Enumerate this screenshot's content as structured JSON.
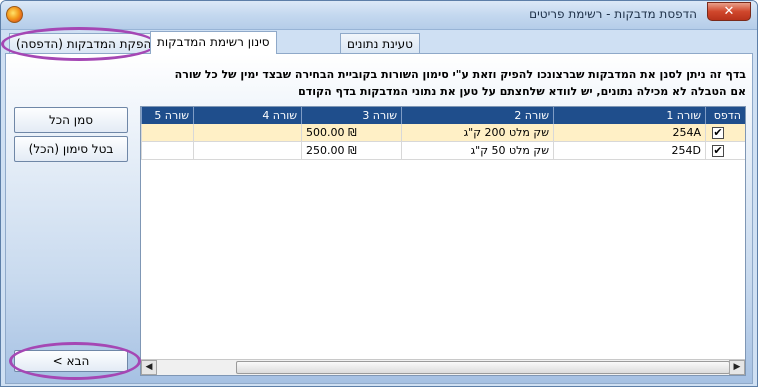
{
  "window": {
    "title": "הדפסת מדבקות - רשימת פריטים",
    "close_label": "✕"
  },
  "tabs": [
    {
      "label": "טעינת נתונים"
    },
    {
      "label": "סינון רשימת המדבקות"
    },
    {
      "label": "הפקת המדבקות (הדפסה)"
    }
  ],
  "instructions": {
    "line1": "בדף זה ניתן לסנן את המדבקות שברצונכו להפיק וזאת ע\"י סימון השורות בקוביית הבחירה שבצד ימין של כל שורה",
    "line2": "אם הטבלה לא מכילה נתונים,  יש לוודא שלחצתם על טען את נתוני המדבקות בדף הקודם"
  },
  "buttons": {
    "select_all": "סמן הכל",
    "deselect_all": "בטל סימון (הכל)",
    "next": "הבא >"
  },
  "grid": {
    "columns": [
      "הדפס",
      "שורה 1",
      "שורה 2",
      "שורה 3",
      "שורה 4",
      "שורה 5"
    ],
    "rows": [
      {
        "print": true,
        "line1": "254A",
        "line2": "שק מלט 200 ק\"ג",
        "line3": "500.00 ₪",
        "line4": "",
        "line5": "",
        "selected": true
      },
      {
        "print": true,
        "line1": "254D",
        "line2": "שק מלט 50 ק\"ג",
        "line3": "250.00 ₪",
        "line4": "",
        "line5": "",
        "selected": false
      }
    ],
    "check_glyph": "✔",
    "scroll_left": "◀",
    "scroll_right": "▶"
  },
  "colors": {
    "header_bg": "#1f4e8c",
    "selected_row": "#fff0c6",
    "annotation_oval": "#a547b4"
  }
}
